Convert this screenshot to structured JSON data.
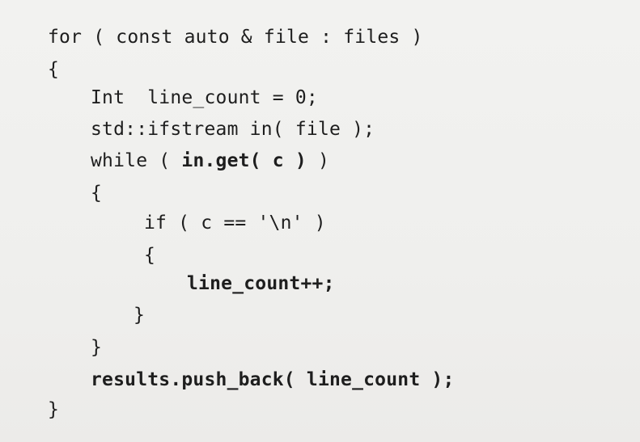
{
  "code_lines": [
    {
      "text": "for ( const auto & file : files )",
      "indent": 0
    },
    {
      "text": "{",
      "indent": 0
    },
    {
      "text": "Int  line_count = 0;",
      "indent": 1
    },
    {
      "text": "std::ifstream in( file );",
      "indent": 1
    },
    {
      "text": "while ( in.get( c ) )",
      "indent": 1
    },
    {
      "text": "{",
      "indent": 1
    },
    {
      "text": "if ( c == '\\n' )",
      "indent": 2
    },
    {
      "text": "{",
      "indent": 2
    },
    {
      "text": "line_count++;",
      "indent": 3
    },
    {
      "text": "}",
      "indent": 2
    },
    {
      "text": "}",
      "indent": 1
    },
    {
      "text": "results.push_back( line_count );",
      "indent": 1
    },
    {
      "text": "}",
      "indent": 0
    }
  ],
  "fragments": {
    "l0": "for ( const auto & file : files )",
    "l1": "{",
    "l2": "Int  line_count = 0;",
    "l3": "std::ifstream in( file );",
    "l4_pre": "while ( ",
    "l4_bold": "in.get( c )",
    "l4_post": " )",
    "l5": "{",
    "l6": "if ( c == '\\n' )",
    "l7": "{",
    "l8": "line_count++;",
    "l9": "}",
    "l10": "}",
    "l11": "results.push_back( line_count );",
    "l12": "}"
  }
}
